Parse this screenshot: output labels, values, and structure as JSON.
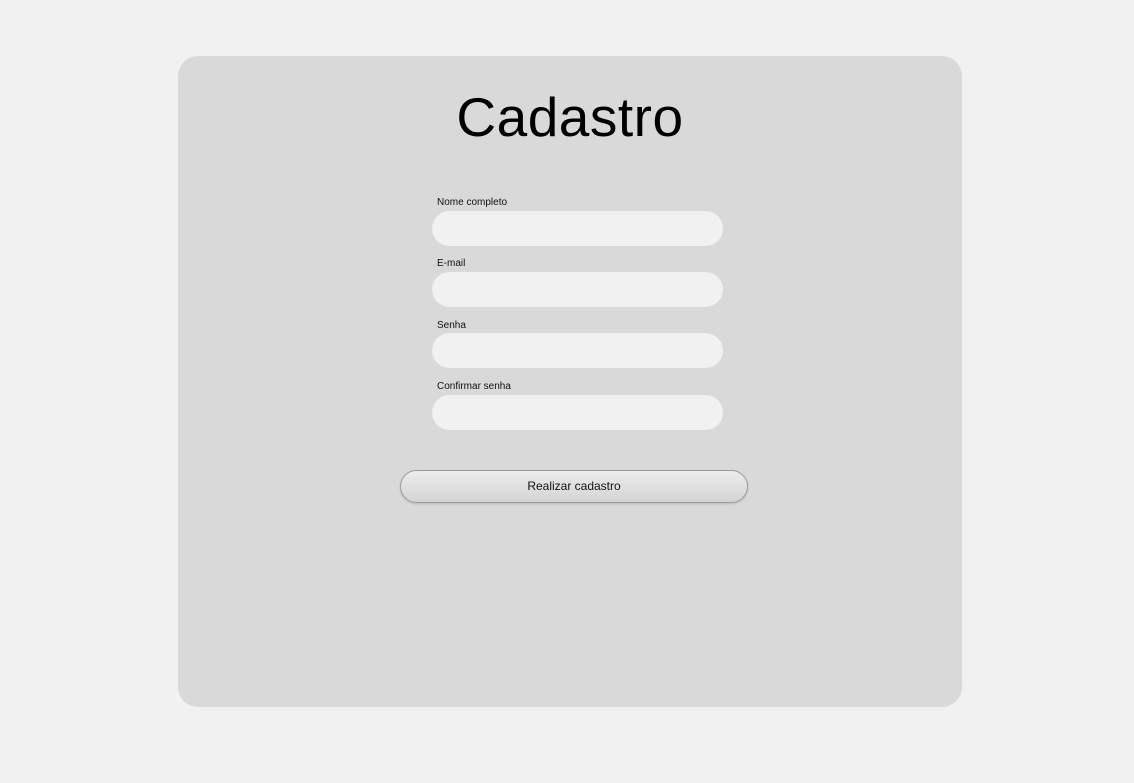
{
  "form": {
    "title": "Cadastro",
    "fields": [
      {
        "label": "Nome completo",
        "value": "",
        "placeholder": ""
      },
      {
        "label": "E-mail",
        "value": "",
        "placeholder": ""
      },
      {
        "label": "Senha",
        "value": "",
        "placeholder": ""
      },
      {
        "label": "Confirmar senha",
        "value": "",
        "placeholder": ""
      }
    ],
    "submit_label": "Realizar cadastro"
  }
}
